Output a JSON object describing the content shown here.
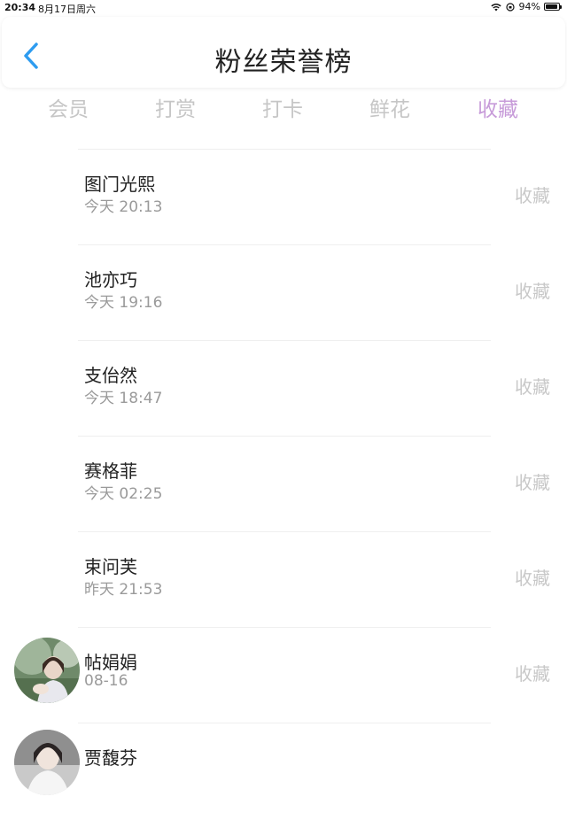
{
  "status_bar": {
    "time": "20:34",
    "date": "8月17日周六",
    "battery": "94%",
    "battery_level": 0.94
  },
  "header": {
    "title": "粉丝荣誉榜",
    "back_icon": "chevron-left-icon",
    "accent_color": "#2e9cf0"
  },
  "tabs": [
    {
      "label": "会员",
      "active": false
    },
    {
      "label": "打赏",
      "active": false
    },
    {
      "label": "打卡",
      "active": false
    },
    {
      "label": "鲜花",
      "active": false
    },
    {
      "label": "收藏",
      "active": true
    }
  ],
  "active_tab_color": "#c79bd9",
  "entries": [
    {
      "name": "图门光熙",
      "time": "今天 20:13",
      "action": "收藏",
      "avatar": false
    },
    {
      "name": "池亦巧",
      "time": "今天 19:16",
      "action": "收藏",
      "avatar": false
    },
    {
      "name": "支佁然",
      "time": "今天 18:47",
      "action": "收藏",
      "avatar": false
    },
    {
      "name": "赛格菲",
      "time": "今天 02:25",
      "action": "收藏",
      "avatar": false
    },
    {
      "name": "束问芙",
      "time": "昨天 21:53",
      "action": "收藏",
      "avatar": false
    },
    {
      "name": "帖娟娟",
      "time": "08-16",
      "action": "收藏",
      "avatar": true
    },
    {
      "name": "贾馥芬",
      "time": "",
      "action": "",
      "avatar": true
    }
  ]
}
